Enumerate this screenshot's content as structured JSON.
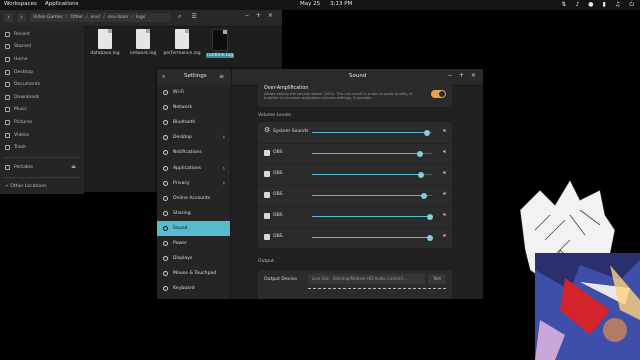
{
  "topbar": {
    "workspaces": "Workspaces",
    "applications": "Applications",
    "date": "May 25",
    "time": "3:13 PM",
    "tray_icons": [
      "network-icon",
      "volume-icon",
      "mic-icon",
      "battery-icon",
      "bell-icon",
      "power-icon"
    ]
  },
  "files_window": {
    "path": [
      "Video Games",
      "Other",
      "osu!",
      "osu-lazer",
      "logs"
    ],
    "sidebar": [
      {
        "label": "Recent",
        "icon": "clock-icon"
      },
      {
        "label": "Starred",
        "icon": "star-icon"
      },
      {
        "label": "Home",
        "icon": "home-icon"
      },
      {
        "label": "Desktop",
        "icon": "desktop-icon"
      },
      {
        "label": "Documents",
        "icon": "document-icon"
      },
      {
        "label": "Downloads",
        "icon": "download-icon"
      },
      {
        "label": "Music",
        "icon": "music-icon"
      },
      {
        "label": "Pictures",
        "icon": "picture-icon"
      },
      {
        "label": "Videos",
        "icon": "video-icon"
      },
      {
        "label": "Trash",
        "icon": "trash-icon"
      }
    ],
    "portable": "Portable",
    "other_locations": "+ Other Locations",
    "files": [
      {
        "name": "database.log",
        "selected": false
      },
      {
        "name": "network.log",
        "selected": false
      },
      {
        "name": "performance.log",
        "selected": false
      },
      {
        "name": "runtime.log",
        "selected": true
      }
    ]
  },
  "settings": {
    "sidebar_title": "Settings",
    "page_title": "Sound",
    "items": [
      {
        "label": "Wi-Fi",
        "chevron": false,
        "active": false
      },
      {
        "label": "Network",
        "chevron": false,
        "active": false
      },
      {
        "label": "Bluetooth",
        "chevron": false,
        "active": false
      },
      {
        "label": "Desktop",
        "chevron": true,
        "active": false
      },
      {
        "label": "Notifications",
        "chevron": false,
        "active": false
      },
      {
        "label": "Applications",
        "chevron": true,
        "active": false
      },
      {
        "label": "Privacy",
        "chevron": true,
        "active": false
      },
      {
        "label": "Online Accounts",
        "chevron": false,
        "active": false
      },
      {
        "label": "Sharing",
        "chevron": false,
        "active": false
      },
      {
        "label": "Sound",
        "chevron": false,
        "active": true
      },
      {
        "label": "Power",
        "chevron": false,
        "active": false
      },
      {
        "label": "Displays",
        "chevron": false,
        "active": false
      },
      {
        "label": "Mouse & Touchpad",
        "chevron": false,
        "active": false
      },
      {
        "label": "Keyboard",
        "chevron": false,
        "active": false
      }
    ],
    "over_amplification": {
      "title": "Over-Amplification",
      "description": "Allows raising the volume above 100%. This can result in a loss of audio quality; it is better to increase application volume settings, if possible.",
      "enabled": true
    },
    "volume_levels_label": "Volume Levels",
    "volume_rows": [
      {
        "name": "System Sounds",
        "icon": "gear-icon",
        "level": 0.96
      },
      {
        "name": "OBS",
        "icon": "app-icon",
        "level": 0.9
      },
      {
        "name": "OBS",
        "icon": "app-icon",
        "level": 0.91
      },
      {
        "name": "OBS",
        "icon": "app-icon",
        "level": 0.93
      },
      {
        "name": "OBS",
        "icon": "app-icon",
        "level": 0.98
      },
      {
        "name": "OBS",
        "icon": "app-icon",
        "level": 0.98
      }
    ],
    "output_label": "Output",
    "output_device_label": "Output Device",
    "output_device_value": "Line Out - Starship/Matisse HD Audio Controll...",
    "test_label": "Test"
  }
}
